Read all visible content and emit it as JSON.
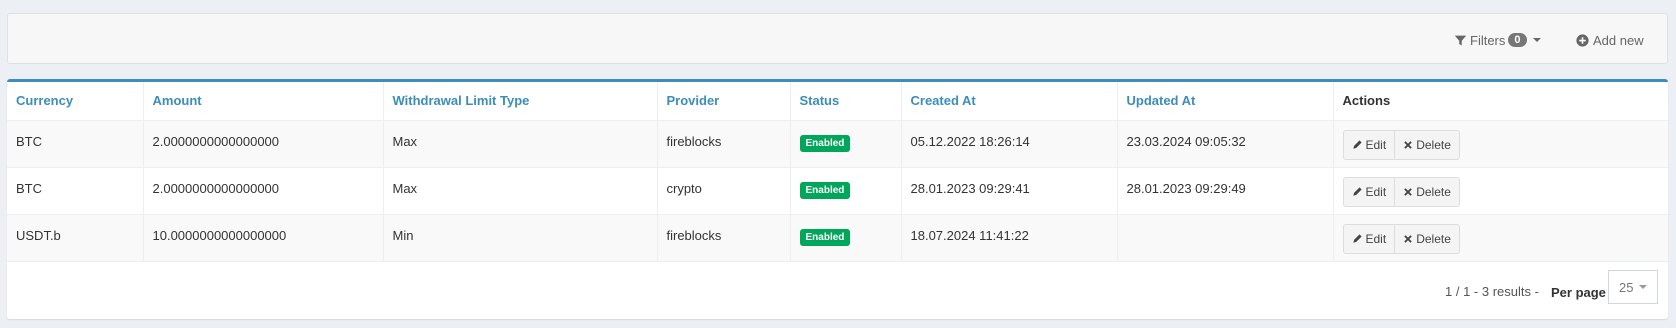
{
  "toolbar": {
    "filters_label": "Filters",
    "filters_count": "0",
    "add_new_label": "Add new"
  },
  "table": {
    "columns": [
      "Currency",
      "Amount",
      "Withdrawal Limit Type",
      "Provider",
      "Status",
      "Created At",
      "Updated At",
      "Actions"
    ],
    "rows": [
      {
        "currency": "BTC",
        "amount": "2.0000000000000000",
        "limit_type": "Max",
        "provider": "fireblocks",
        "status": "Enabled",
        "created_at": "05.12.2022 18:26:14",
        "updated_at": "23.03.2024 09:05:32"
      },
      {
        "currency": "BTC",
        "amount": "2.0000000000000000",
        "limit_type": "Max",
        "provider": "crypto",
        "status": "Enabled",
        "created_at": "28.01.2023 09:29:41",
        "updated_at": "28.01.2023 09:29:49"
      },
      {
        "currency": "USDT.b",
        "amount": "10.0000000000000000",
        "limit_type": "Min",
        "provider": "fireblocks",
        "status": "Enabled",
        "created_at": "18.07.2024 11:41:22",
        "updated_at": ""
      }
    ],
    "actions": {
      "edit_label": "Edit",
      "delete_label": "Delete"
    }
  },
  "footer": {
    "pagination_info": "1 / 1  -  3 results  -",
    "per_page_label": "Per page",
    "per_page_value": "25"
  },
  "colors": {
    "accent": "#3c8dbc",
    "status_enabled": "#00a65a"
  }
}
